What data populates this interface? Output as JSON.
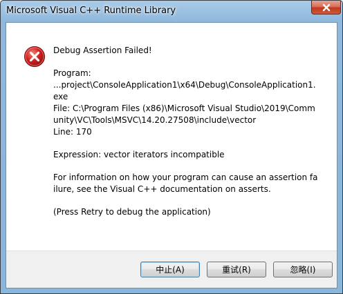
{
  "window": {
    "title": "Microsoft Visual C++ Runtime Library"
  },
  "icons": {
    "error": "error-x-icon",
    "close": "close-icon"
  },
  "colors": {
    "error_red": "#d0201f",
    "close_button": "#c2381c",
    "title_bar": "#a9cbe8",
    "footer_bg": "#f0f0f0"
  },
  "message": {
    "heading": "Debug Assertion Failed!",
    "program": "Program:\n...project\\ConsoleApplication1\\x64\\Debug\\ConsoleApplication1.exe\nFile: C:\\Program Files (x86)\\Microsoft Visual Studio\\2019\\Community\\VC\\Tools\\MSVC\\14.20.27508\\include\\vector\nLine: 170",
    "expression": "Expression: vector iterators incompatible",
    "info": "For information on how your program can cause an assertion failure, see the Visual C++ documentation on asserts.",
    "hint": "(Press Retry to debug the application)"
  },
  "buttons": {
    "abort": "中止(A)",
    "retry": "重试(R)",
    "ignore": "忽略(I)"
  }
}
